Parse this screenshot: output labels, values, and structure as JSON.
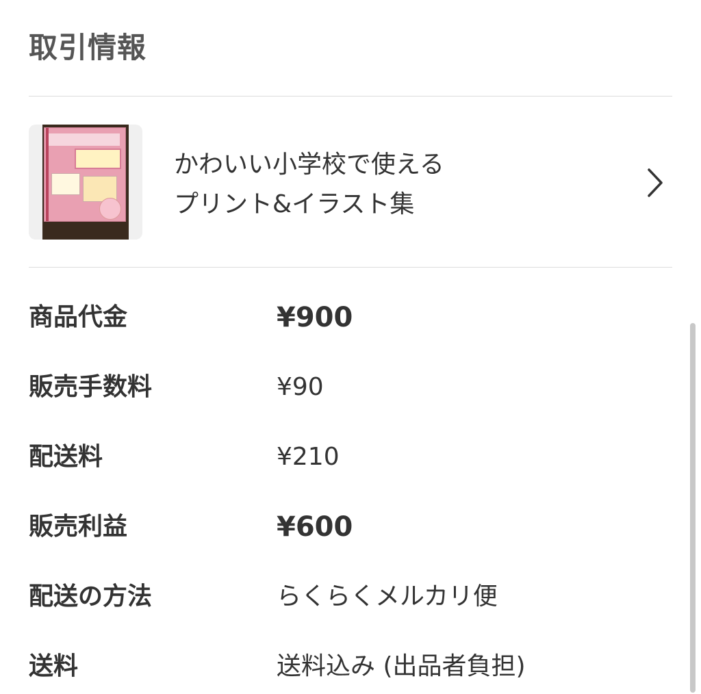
{
  "section": {
    "title": "取引情報"
  },
  "product": {
    "thumbnail_alt": "商品画像",
    "name_line1": "かわいい小学校で使える",
    "name_line2": "プリント&イラスト集"
  },
  "details": [
    {
      "label": "商品代金",
      "value": "¥900",
      "emphasis": true
    },
    {
      "label": "販売手数料",
      "value": "¥90",
      "emphasis": false
    },
    {
      "label": "配送料",
      "value": "¥210",
      "emphasis": false
    },
    {
      "label": "販売利益",
      "value": "¥600",
      "emphasis": true
    },
    {
      "label": "配送の方法",
      "value": "らくらくメルカリ便",
      "emphasis": false
    },
    {
      "label": "送料",
      "value": "送料込み (出品者負担)",
      "emphasis": false
    }
  ],
  "icons": {
    "chevron": "chevron-right-icon"
  },
  "colors": {
    "text": "#333333",
    "title": "#555555",
    "divider": "#dcdcdc",
    "background": "#ffffff"
  }
}
